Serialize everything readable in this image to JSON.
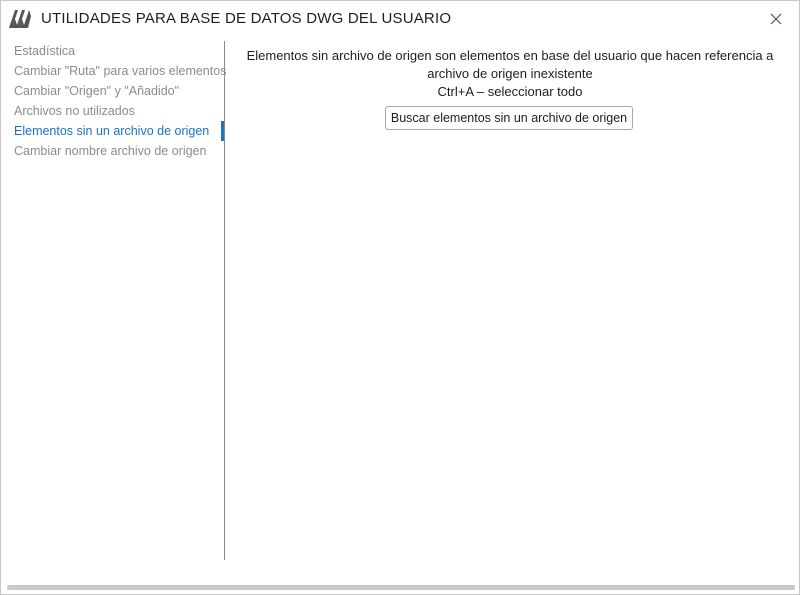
{
  "window": {
    "title": "UTILIDADES PARA BASE DE DATOS DWG DEL USUARIO"
  },
  "sidebar": {
    "items": [
      {
        "label": "Estadística",
        "active": false
      },
      {
        "label": "Cambiar \"Ruta\" para varios elementos",
        "active": false
      },
      {
        "label": "Cambiar \"Origen\" y \"Añadido\"",
        "active": false
      },
      {
        "label": "Archivos no utilizados",
        "active": false
      },
      {
        "label": "Elementos sin un archivo de origen",
        "active": true
      },
      {
        "label": "Cambiar nombre archivo de origen",
        "active": false
      }
    ]
  },
  "main": {
    "description_line1": "Elementos sin archivo de origen son elementos en base del usuario que hacen referencia a",
    "description_line2": "archivo de origen inexistente",
    "shortcut_hint": "Ctrl+A – seleccionar todo",
    "search_button_label": "Buscar elementos sin un archivo de origen"
  },
  "icons": {
    "app_logo": "app-logo-icon",
    "close": "close-icon"
  },
  "colors": {
    "accent": "#1a73c7",
    "inactive_text": "#8c8c8c",
    "logo": "#555555"
  }
}
